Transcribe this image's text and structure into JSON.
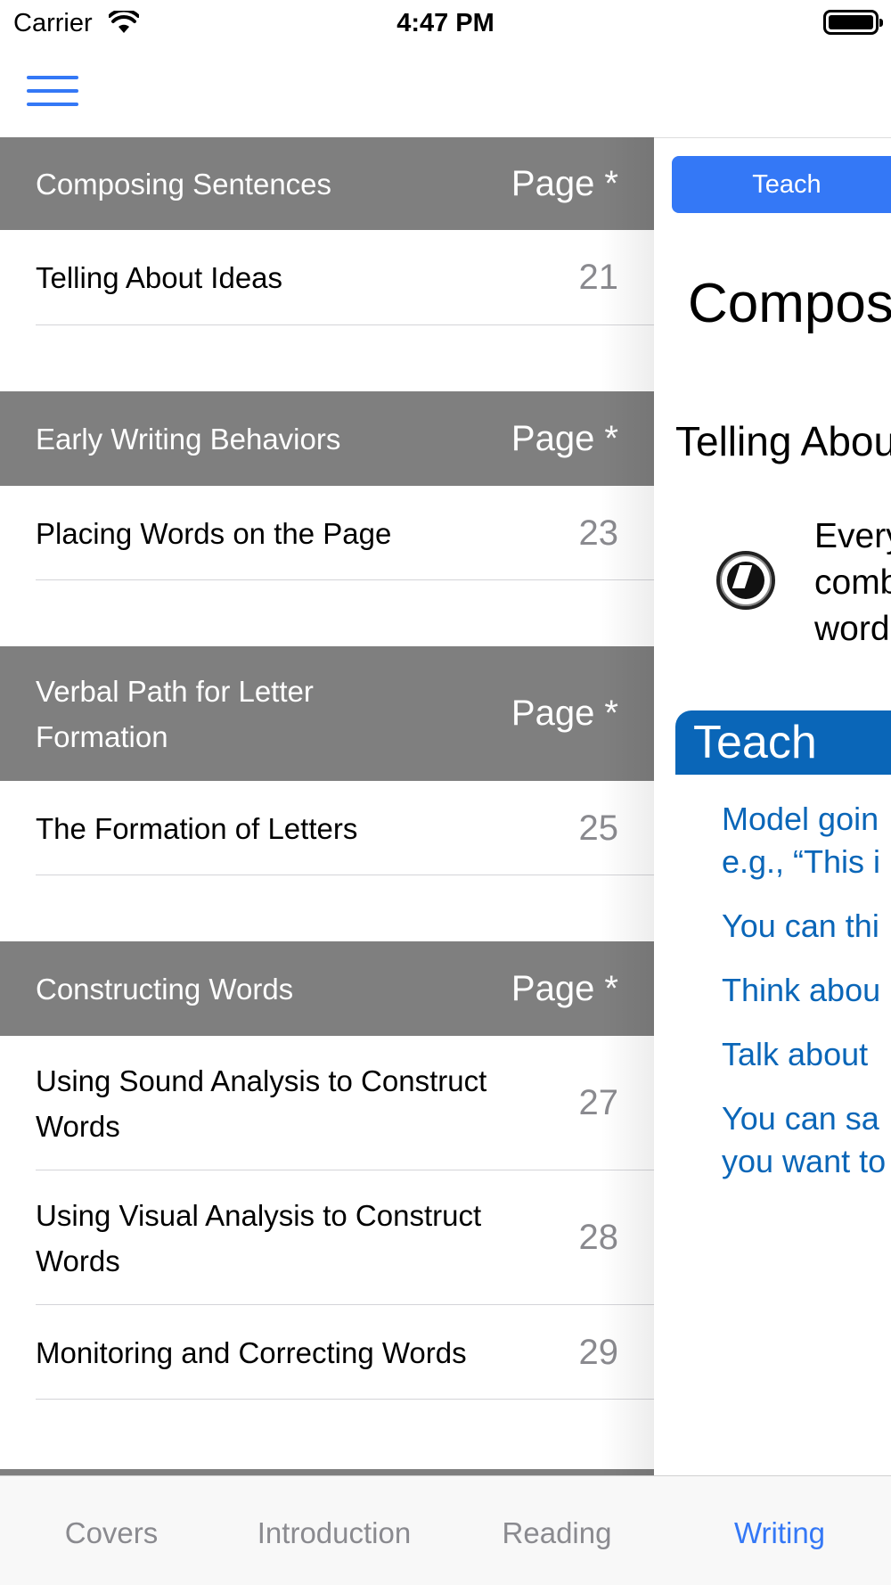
{
  "status_bar": {
    "carrier": "Carrier",
    "time": "4:47 PM"
  },
  "nav": {
    "menu_icon": "hamburger-menu-icon"
  },
  "toc": {
    "sections": [
      {
        "title": "Composing Sentences",
        "page_label": "Page *",
        "rows": [
          {
            "label": "Telling About Ideas",
            "page": "21"
          }
        ]
      },
      {
        "title": "Early Writing Behaviors",
        "page_label": "Page *",
        "rows": [
          {
            "label": "Placing Words on the Page",
            "page": "23"
          }
        ]
      },
      {
        "title": "Verbal Path for Letter Formation",
        "page_label": "Page *",
        "rows": [
          {
            "label": "The Formation of Letters",
            "page": "25"
          }
        ]
      },
      {
        "title": "Constructing Words",
        "page_label": "Page *",
        "rows": [
          {
            "label": "Using Sound Analysis to Construct Words",
            "page": "27"
          },
          {
            "label": "Using Visual Analysis to Construct Words",
            "page": "28"
          },
          {
            "label": "Monitoring and Correcting Words",
            "page": "29"
          }
        ]
      }
    ]
  },
  "detail": {
    "teach_button": "Teach",
    "title": "Compos",
    "subtitle": "Telling Abou",
    "paragraph_lines": [
      "Every",
      "comb",
      "word"
    ],
    "teach_banner": "Teach",
    "teach_lines": [
      [
        "Model goin",
        "e.g., “This i"
      ],
      [
        "You can thi"
      ],
      [
        "Think abou"
      ],
      [
        "Talk about"
      ],
      [
        "You can sa",
        "you want to"
      ]
    ]
  },
  "tabs": [
    {
      "label": "Covers",
      "active": false
    },
    {
      "label": "Introduction",
      "active": false
    },
    {
      "label": "Reading",
      "active": false
    },
    {
      "label": "Writing",
      "active": true
    }
  ],
  "colors": {
    "accent": "#3478f6",
    "section_header": "#7f7f7f",
    "teach_blue": "#0a66b8"
  }
}
